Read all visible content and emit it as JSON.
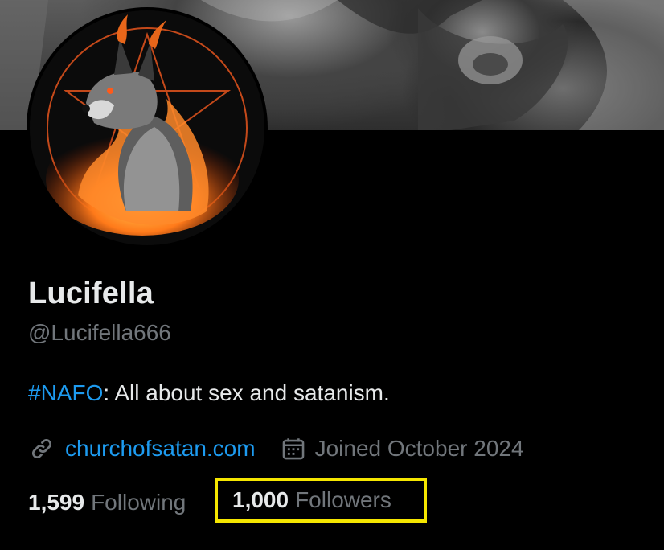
{
  "profile": {
    "display_name": "Lucifella",
    "handle": "@Lucifella666",
    "bio_hashtag": "#NAFO",
    "bio_text": ": All about sex and satanism.",
    "website": "churchofsatan.com",
    "joined": "Joined October 2024"
  },
  "stats": {
    "following_count": "1,599",
    "following_label": "Following",
    "followers_count": "1,000",
    "followers_label": "Followers"
  },
  "icons": {
    "link": "link-icon",
    "calendar": "calendar-icon"
  },
  "colors": {
    "background": "#000000",
    "link": "#1d9bf0",
    "secondary_text": "#71767b",
    "primary_text": "#e7e9ea",
    "highlight_box": "#f5e600"
  }
}
